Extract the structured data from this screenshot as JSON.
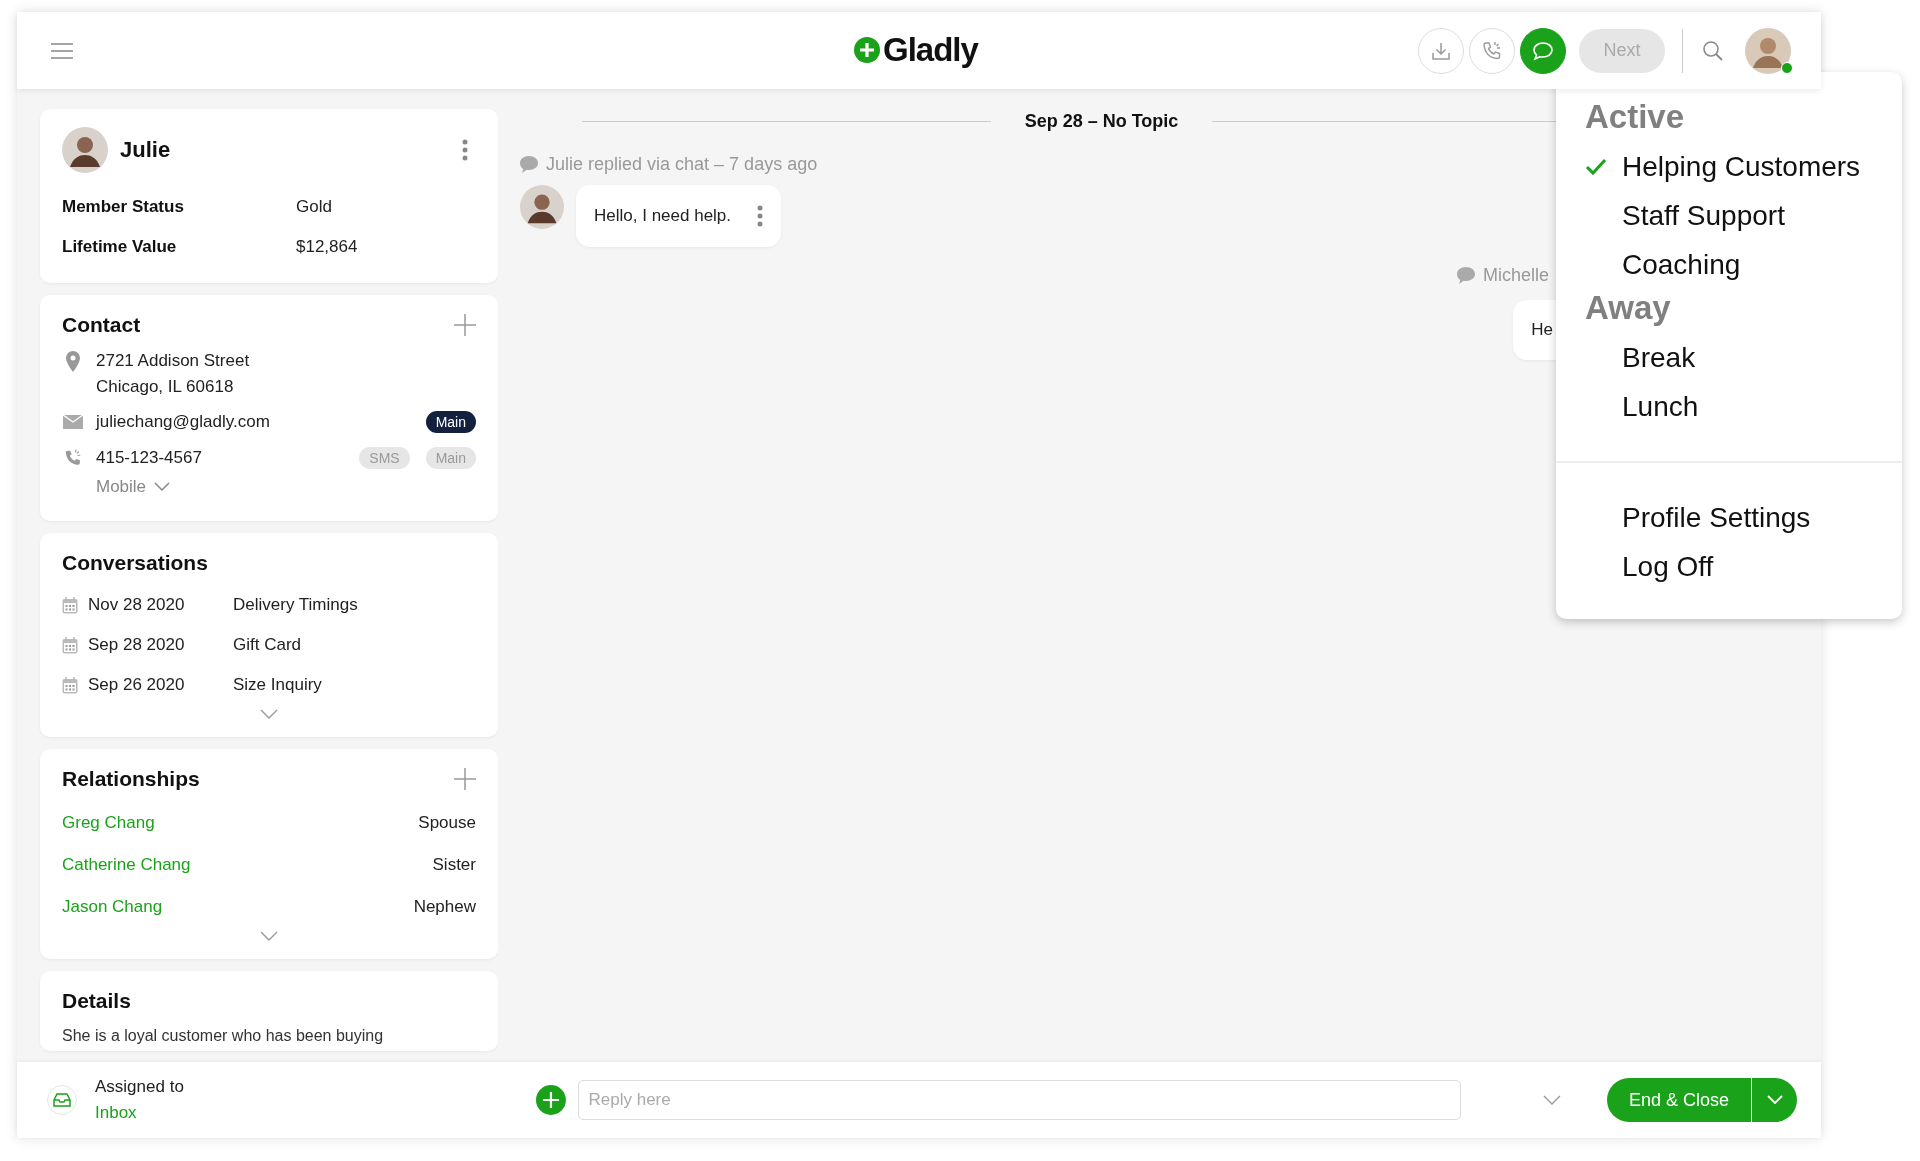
{
  "top_bar": {
    "logo": "Gladly",
    "channel_buttons": [
      {
        "kind": "download",
        "selected": false
      },
      {
        "kind": "phone",
        "selected": false
      },
      {
        "kind": "chat",
        "selected": true
      }
    ],
    "next_button": {
      "label": "Next",
      "disabled": true
    },
    "user": {
      "online": true
    }
  },
  "customer": {
    "name": "Julie",
    "fields": [
      {
        "label": "Member Status",
        "value": "Gold"
      },
      {
        "label": "Lifetime Value",
        "value": "$12,864"
      }
    ]
  },
  "contact": {
    "title": "Contact",
    "address": [
      "2721 Addison Street",
      "Chicago, IL 60618"
    ],
    "email": {
      "value": "juliechang@gladly.com",
      "tags": [
        {
          "label": "Main",
          "primary": true
        }
      ]
    },
    "phone": {
      "value": "415-123-4567",
      "tags": [
        {
          "label": "SMS",
          "primary": false
        },
        {
          "label": "Main",
          "primary": false
        }
      ],
      "type": "Mobile"
    }
  },
  "conversations": {
    "title": "Conversations",
    "items": [
      {
        "date": "Nov 28 2020",
        "topic": "Delivery Timings"
      },
      {
        "date": "Sep 28 2020",
        "topic": "Gift Card"
      },
      {
        "date": "Sep 26 2020",
        "topic": "Size Inquiry"
      }
    ]
  },
  "relationships": {
    "title": "Relationships",
    "items": [
      {
        "name": "Greg Chang",
        "relation": "Spouse"
      },
      {
        "name": "Catherine Chang",
        "relation": "Sister"
      },
      {
        "name": "Jason Chang",
        "relation": "Nephew"
      }
    ]
  },
  "details": {
    "title": "Details",
    "text": "She is a loyal customer who has been buying"
  },
  "chat": {
    "divider": "Sep 28 – No Topic",
    "messages": [
      {
        "kind": "customer",
        "meta": "Julie replied via chat – 7 days ago",
        "text": "Hello, I need help."
      },
      {
        "kind": "agent",
        "meta": "Michelle",
        "text": "He"
      }
    ]
  },
  "bottom_bar": {
    "assigned_label": "Assigned to",
    "assigned_value": "Inbox",
    "reply_placeholder": "Reply here",
    "end_button": "End & Close"
  },
  "status_menu": {
    "sections": [
      {
        "heading": "Active",
        "items": [
          {
            "label": "Helping Customers",
            "selected": true
          },
          {
            "label": "Staff Support",
            "selected": false
          },
          {
            "label": "Coaching",
            "selected": false
          }
        ]
      },
      {
        "heading": "Away",
        "items": [
          {
            "label": "Break",
            "selected": false
          },
          {
            "label": "Lunch",
            "selected": false
          }
        ]
      }
    ],
    "actions": [
      "Profile Settings",
      "Log Off"
    ]
  }
}
